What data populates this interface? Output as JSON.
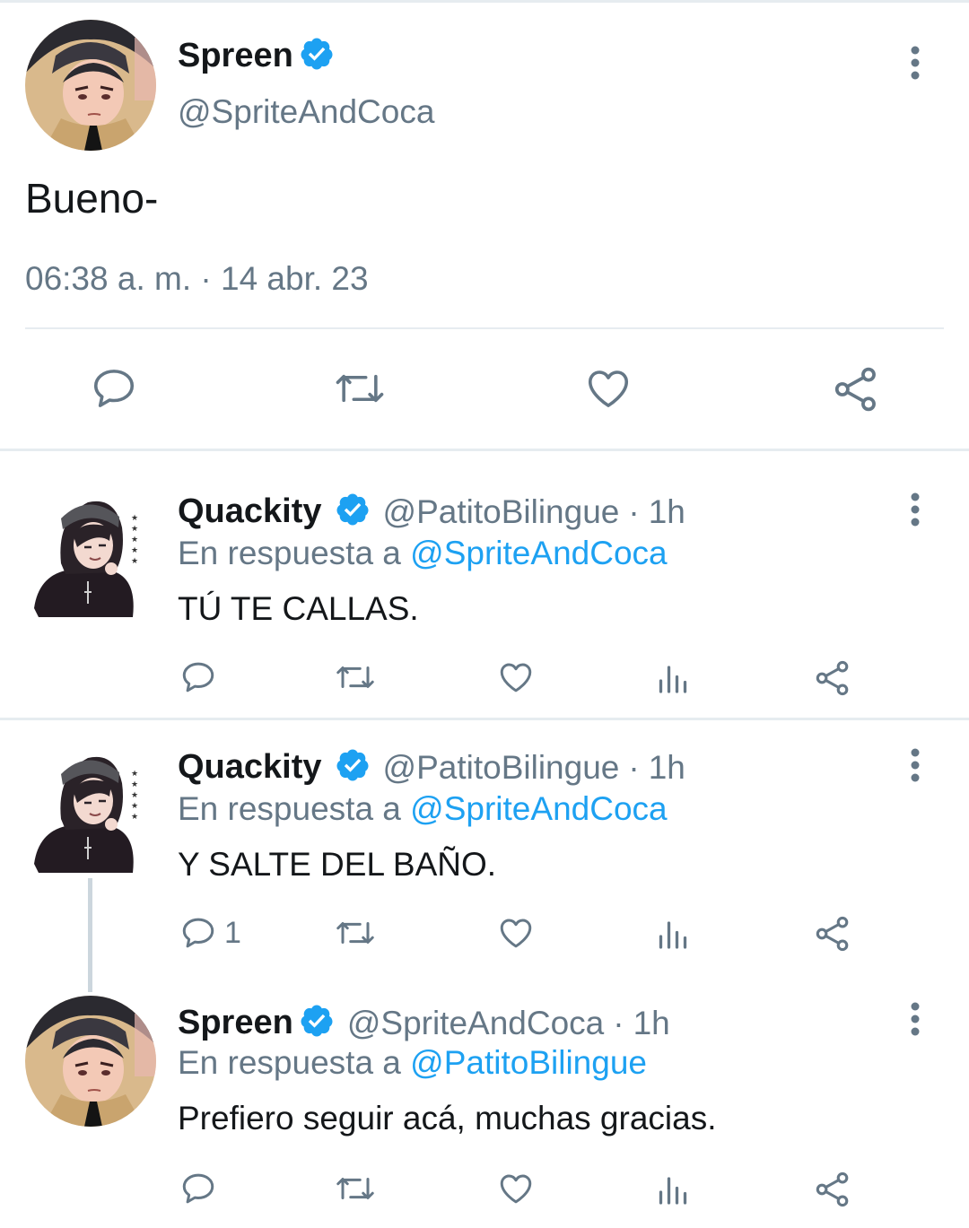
{
  "colors": {
    "text": "#14171a",
    "secondary": "#657786",
    "accent": "#1da1f2",
    "divider": "#e6ecf0"
  },
  "main_tweet": {
    "name": "Spreen",
    "handle": "@SpriteAndCoca",
    "text": "Bueno-",
    "timestamp": "06:38 a. m. · 14 abr. 23",
    "actions": [
      "reply-icon",
      "retweet-icon",
      "like-icon",
      "share-icon"
    ]
  },
  "replies": [
    {
      "name": "Quackity",
      "handle": "@PatitoBilingue",
      "separator": "·",
      "time": "1h",
      "reply_prefix": "En respuesta a",
      "reply_to": "@SpriteAndCoca",
      "text": "TÚ TE CALLAS.",
      "reply_count": ""
    },
    {
      "name": "Quackity",
      "handle": "@PatitoBilingue",
      "separator": "·",
      "time": "1h",
      "reply_prefix": "En respuesta a",
      "reply_to": "@SpriteAndCoca",
      "text": "Y SALTE DEL BAÑO.",
      "reply_count": "1"
    },
    {
      "name": "Spreen",
      "handle": "@SpriteAndCoca",
      "separator": "·",
      "time": "1h",
      "reply_prefix": "En respuesta a",
      "reply_to": "@PatitoBilingue",
      "text": "Prefiero seguir acá, muchas gracias.",
      "reply_count": ""
    }
  ]
}
